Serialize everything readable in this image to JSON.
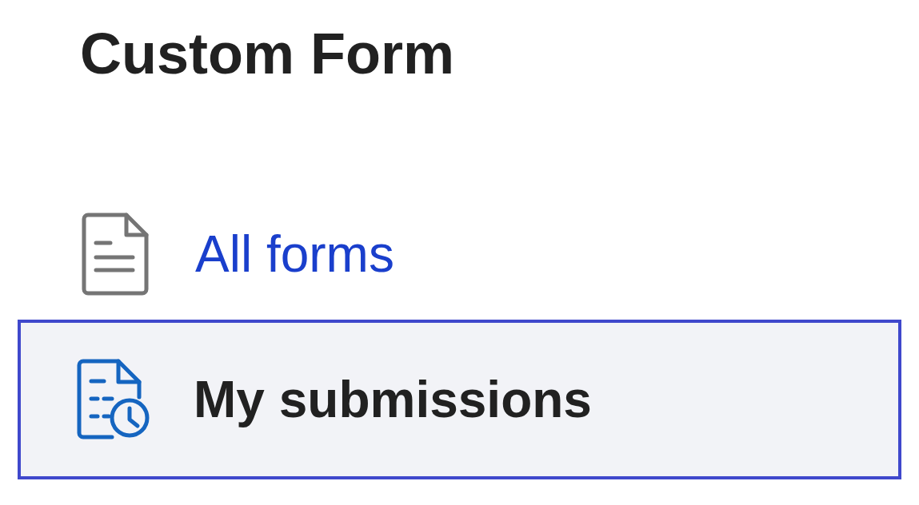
{
  "title": "Custom Form",
  "nav": [
    {
      "label": "All forms",
      "kind": "forms",
      "selected": false
    },
    {
      "label": "My submissions",
      "kind": "submissions",
      "selected": true
    }
  ]
}
